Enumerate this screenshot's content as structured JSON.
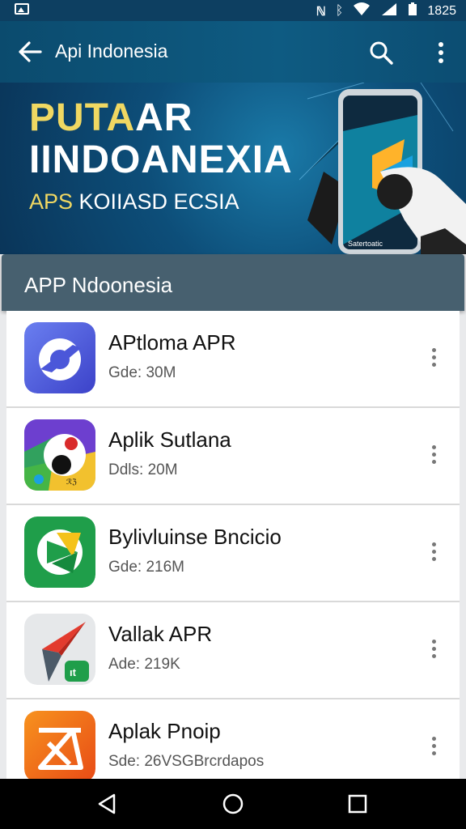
{
  "status_bar": {
    "time": "1825"
  },
  "app_bar": {
    "title": "Api Indonesia"
  },
  "banner": {
    "line1_part1": "PUTA",
    "line1_part2": "AR",
    "line2": "IINDOANEXIA",
    "line3_part1": "APS ",
    "line3_part2": "KOIIASD ECSIA",
    "phone_caption": "Satertoatic"
  },
  "section": {
    "title": "APP Ndoonesia"
  },
  "apps": [
    {
      "name": "APtloma APR",
      "size": "Gde: 30M",
      "icon": "blue-dash-app-icon",
      "color": "#4b57d9"
    },
    {
      "name": "Aplik Sutlana",
      "size": "Ddls: 20M",
      "icon": "colorful-ball-app-icon",
      "color": "#2b8bd4"
    },
    {
      "name": "Bylivluinse Bncicio",
      "size": "Gde: 216M",
      "icon": "green-play-app-icon",
      "color": "#1f9e4a"
    },
    {
      "name": "Vallak APR",
      "size": "Ade: 219K",
      "icon": "red-arrow-app-icon",
      "color": "#d94a3a"
    },
    {
      "name": "Aplak Pnoip",
      "size": "Sde: 26VSGBrcrdapos",
      "icon": "orange-triangle-app-icon",
      "color": "#f2681e"
    }
  ],
  "nav": {
    "back": "back-triangle-icon",
    "home": "home-circle-icon",
    "recents": "recents-square-icon"
  }
}
